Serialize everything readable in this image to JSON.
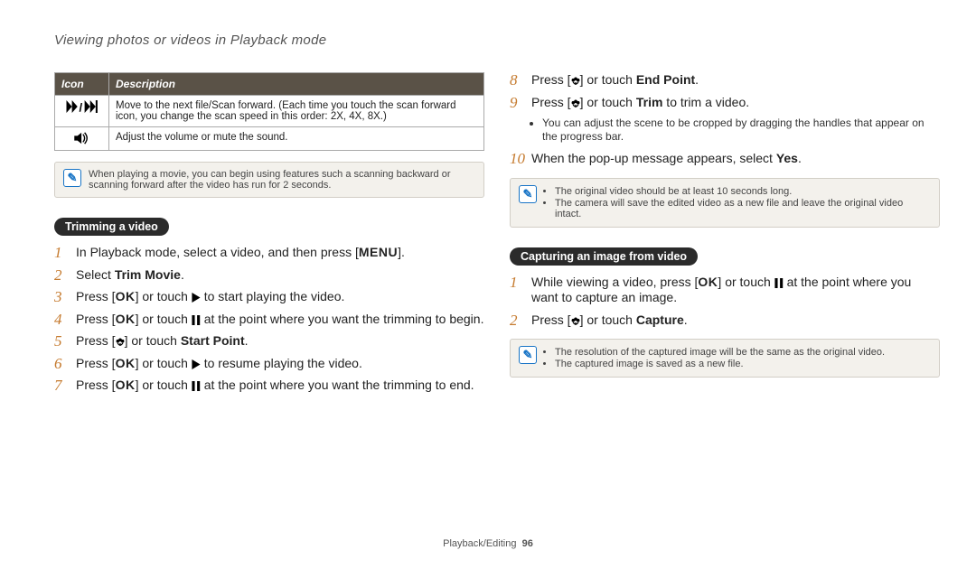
{
  "page_title": "Viewing photos or videos in Playback mode",
  "icon_table": {
    "cols": {
      "icon": "Icon",
      "desc": "Description"
    },
    "rows": [
      {
        "icon_name": "scan-forward-icon",
        "desc": "Move to the next file/Scan forward. (Each time you touch the scan forward icon, you change the scan speed in this order: 2X, 4X, 8X.)"
      },
      {
        "icon_name": "volume-icon",
        "desc": "Adjust the volume or mute the sound."
      }
    ]
  },
  "note_scan": "When playing a movie, you can begin using features such a scanning backward or scanning forward after the video has run for 2 seconds.",
  "trim_section": {
    "heading": "Trimming a video",
    "steps": [
      {
        "pre": "In Playback mode, select a video, and then press [",
        "key": "MENU",
        "key_kind": "menu",
        "post": "]."
      },
      {
        "pre": "Select ",
        "bold": "Trim Movie",
        "post": "."
      },
      {
        "pre": "Press [",
        "key": "OK",
        "glyph_after": "play",
        "mid": "] or touch ",
        "post2": " to start playing the video."
      },
      {
        "pre": "Press [",
        "key": "OK",
        "glyph_after": "pause",
        "mid": "] or touch ",
        "post2": " at the point where you want the trimming to begin."
      },
      {
        "pre": "Press [",
        "key_glyph": "macro",
        "mid": "] or touch ",
        "bold_after": "Start Point",
        "post": "."
      },
      {
        "pre": "Press [",
        "key": "OK",
        "glyph_after": "play",
        "mid": "] or touch ",
        "post2": " to resume playing the video."
      },
      {
        "pre": "Press [",
        "key": "OK",
        "glyph_after": "pause",
        "mid": "] or touch ",
        "post2": " at the point where you want the trimming to end."
      }
    ]
  },
  "trim_section_cont": {
    "steps": [
      {
        "pre": "Press [",
        "key_glyph": "macro",
        "mid": "] or touch ",
        "bold_after": "End Point",
        "post": "."
      },
      {
        "pre": "Press [",
        "key_glyph": "macro",
        "mid": "] or touch ",
        "bold_after": "Trim",
        "post": " to trim a video."
      }
    ],
    "sub": "You can adjust the scene to be cropped by dragging the handles that appear on the progress bar.",
    "step_final": {
      "pre": "When the pop-up message appears, select ",
      "bold": "Yes",
      "post": "."
    },
    "note_items": [
      "The original video should be at least 10 seconds long.",
      "The camera will save the edited video as a new file and leave the original video intact."
    ]
  },
  "capture_section": {
    "heading": "Capturing an image from video",
    "steps": [
      {
        "pre": "While viewing a video, press [",
        "key": "OK",
        "glyph_after": "pause",
        "mid": "] or touch ",
        "post2": " at the point where you want to capture an image."
      },
      {
        "pre": "Press [",
        "key_glyph": "macro",
        "mid": "] or touch ",
        "bold_after": "Capture",
        "post": "."
      }
    ],
    "note_items": [
      "The resolution of the captured image will be the same as the original video.",
      "The captured image is saved as a new file."
    ]
  },
  "footer": {
    "section": "Playback/Editing",
    "page": "96"
  }
}
